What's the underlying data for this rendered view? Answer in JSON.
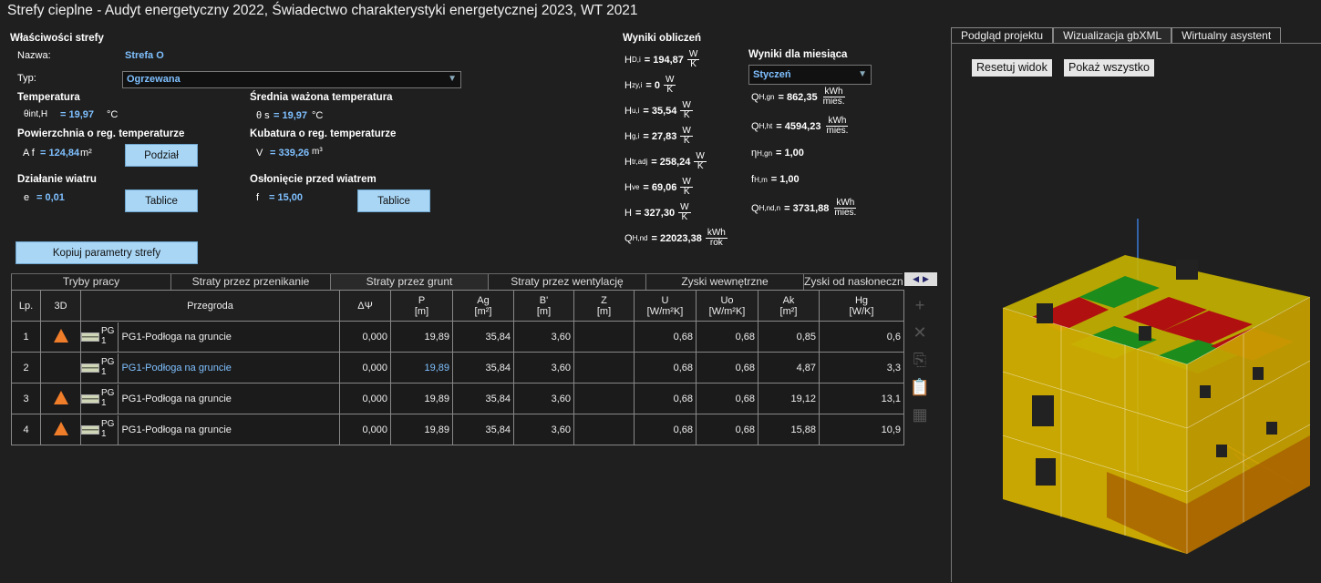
{
  "window": {
    "title": "Strefy cieplne - Audyt energetyczny 2022, Świadectwo charakterystyki energetycznej 2023, WT 2021"
  },
  "props": {
    "section_title": "Właściwości strefy",
    "name_label": "Nazwa:",
    "name_value": "Strefa O",
    "type_label": "Typ:",
    "type_value": "Ogrzewana",
    "temp_title": "Temperatura",
    "temp_sym": "θint,H",
    "temp_value": "= 19,97",
    "temp_unit": "°C",
    "avg_temp_title": "Średnia ważona temperatura",
    "avg_temp_sym": "θ s",
    "avg_temp_value": "= 19,97",
    "avg_temp_unit": "°C",
    "area_title": "Powierzchnia o reg. temperaturze",
    "area_sym": "A f",
    "area_value": "= 124,84",
    "area_unit": "m²",
    "split_button": "Podział",
    "volume_title": "Kubatura o reg. temperaturze",
    "volume_sym": "V",
    "volume_value": "= 339,26",
    "volume_unit": "m³",
    "wind_title": "Działanie wiatru",
    "wind_sym": "e",
    "wind_value": "= 0,01",
    "wind_button": "Tablice",
    "shield_title": "Osłonięcie przed wiatrem",
    "shield_sym": "f",
    "shield_value": "= 15,00",
    "shield_button": "Tablice",
    "copy_button": "Kopiuj parametry strefy"
  },
  "results": {
    "title": "Wyniki obliczeń",
    "items": [
      {
        "sym": "H",
        "sub": "D,i",
        "value": "= 194,87",
        "num": "W",
        "den": "K"
      },
      {
        "sym": "H",
        "sub": "zy,i",
        "value": "= 0",
        "num": "W",
        "den": "K"
      },
      {
        "sym": "H",
        "sub": "u,i",
        "value": "= 35,54",
        "num": "W",
        "den": "K"
      },
      {
        "sym": "H",
        "sub": "g,i",
        "value": "= 27,83",
        "num": "W",
        "den": "K"
      },
      {
        "sym": "H",
        "sub": "tr,adj",
        "value": "= 258,24",
        "num": "W",
        "den": "K"
      },
      {
        "sym": "H",
        "sub": "ve",
        "value": "= 69,06",
        "num": "W",
        "den": "K"
      },
      {
        "sym": "H",
        "sub": "",
        "value": "= 327,30",
        "num": "W",
        "den": "K"
      },
      {
        "sym": "Q",
        "sub": "H,nd",
        "value": "= 22023,38",
        "num": "kWh",
        "den": "rok"
      }
    ]
  },
  "monthly": {
    "title": "Wyniki dla miesiąca",
    "month": "Styczeń",
    "items": [
      {
        "sym": "Q",
        "sub": "H,gn",
        "value": "= 862,35",
        "num": "kWh",
        "den": "mies."
      },
      {
        "sym": "Q",
        "sub": "H,ht",
        "value": "= 4594,23",
        "num": "kWh",
        "den": "mies."
      },
      {
        "sym": "η",
        "sub": "H,gn",
        "value": "= 1,00",
        "num": "",
        "den": ""
      },
      {
        "sym": "f",
        "sub": "H,m",
        "value": "= 1,00",
        "num": "",
        "den": ""
      },
      {
        "sym": "Q",
        "sub": "H,nd,n",
        "value": "= 3731,88",
        "num": "kWh",
        "den": "mies."
      }
    ]
  },
  "tabs": [
    "Tryby pracy",
    "Straty przez przenikanie",
    "Straty przez grunt",
    "Straty przez wentylację",
    "Zyski wewnętrzne",
    "Zyski od nasłonecznienia"
  ],
  "table": {
    "headers": [
      "Lp.",
      "3D",
      "Przegroda",
      "ΔΨ",
      "P\n[m]",
      "Ag\n[m²]",
      "B'\n[m]",
      "Z\n[m]",
      "U\n[W/m²K]",
      "Uo\n[W/m²K]",
      "Ak\n[m²]",
      "Hg\n[W/K]"
    ],
    "rows": [
      {
        "lp": "1",
        "has3d": true,
        "pg": "PG\n1",
        "name": "PG1-Podłoga na gruncie",
        "dpsi": "0,000",
        "p": "19,89",
        "ag": "35,84",
        "b": "3,60",
        "z": "",
        "u": "0,68",
        "uo": "0,68",
        "ak": "0,85",
        "hg": "0,6"
      },
      {
        "lp": "2",
        "has3d": false,
        "pg": "PG\n1",
        "name": "PG1-Podłoga na gruncie",
        "dpsi": "0,000",
        "p": "19,89",
        "ag": "35,84",
        "b": "3,60",
        "z": "",
        "u": "0,68",
        "uo": "0,68",
        "ak": "4,87",
        "hg": "3,3"
      },
      {
        "lp": "3",
        "has3d": true,
        "pg": "PG\n1",
        "name": "PG1-Podłoga na gruncie",
        "dpsi": "0,000",
        "p": "19,89",
        "ag": "35,84",
        "b": "3,60",
        "z": "",
        "u": "0,68",
        "uo": "0,68",
        "ak": "19,12",
        "hg": "13,1"
      },
      {
        "lp": "4",
        "has3d": true,
        "pg": "PG\n1",
        "name": "PG1-Podłoga na gruncie",
        "dpsi": "0,000",
        "p": "19,89",
        "ag": "35,84",
        "b": "3,60",
        "z": "",
        "u": "0,68",
        "uo": "0,68",
        "ak": "15,88",
        "hg": "10,9"
      }
    ]
  },
  "right": {
    "tabs": [
      "Podgląd projektu",
      "Wizualizacja gbXML",
      "Wirtualny asystent"
    ],
    "reset_button": "Resetuj widok",
    "show_all_button": "Pokaż wszystko"
  },
  "colors": {
    "accent_button": "#a9d6f5",
    "value_blue": "#7fc0ff",
    "triangle": "#f07d2a"
  }
}
